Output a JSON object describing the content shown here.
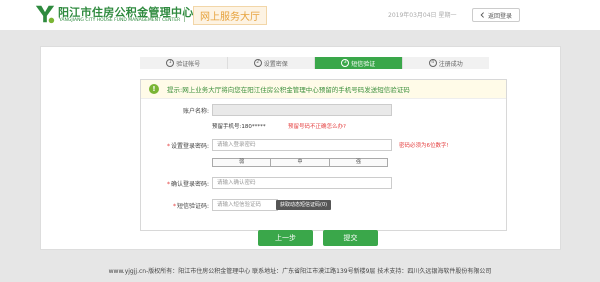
{
  "header": {
    "brand_cn": "阳江市住房公积金管理中心",
    "brand_en": "YANGJIANG CITY HOUSE FUND MANAGEMENT CENTER",
    "hall_title": "网上服务大厅",
    "date_text": "2019年03月04日 星期一",
    "back_label": "返回登录"
  },
  "steps": [
    {
      "num": "1",
      "label": "验证帐号",
      "active": false
    },
    {
      "num": "2",
      "label": "设置密保",
      "active": false
    },
    {
      "num": "3",
      "label": "短信验证",
      "active": true
    },
    {
      "num": "4",
      "label": "注册成功",
      "active": false
    }
  ],
  "notice": {
    "icon": "!",
    "text": "提示:网上业务大厅将向您在阳江住房公积金管理中心预留的手机号码发送短信验证码"
  },
  "form": {
    "account_label": "账户名称:",
    "account_value": "",
    "phone_label": "预留手机号:",
    "phone_value": "180*****",
    "phone_link": "预留号码不正确怎么办?",
    "password_label": "设置登录密码:",
    "password_placeholder": "请输入登录密码",
    "password_hint": "密码必须为6位数字!",
    "strength": [
      "弱",
      "中",
      "强"
    ],
    "confirm_label": "确认登录密码:",
    "confirm_placeholder": "请输入确认密码",
    "sms_label": "短信验证码:",
    "sms_placeholder": "请输入短信验证码",
    "sms_button": "获取动态短信证码(0)"
  },
  "buttons": {
    "prev": "上一步",
    "submit": "提交"
  },
  "footer": {
    "text": "www.yjgjj.cn-版权所有：阳江市住房公积金管理中心 联系地址：广东省阳江市漠江路139号新楼9层 技术支持：四川久远银海软件股份有限公司"
  },
  "colors": {
    "accent": "#3aa74a",
    "brand": "#2e8a3e",
    "warning": "#e43d3d",
    "hall": "#e6a23c"
  }
}
